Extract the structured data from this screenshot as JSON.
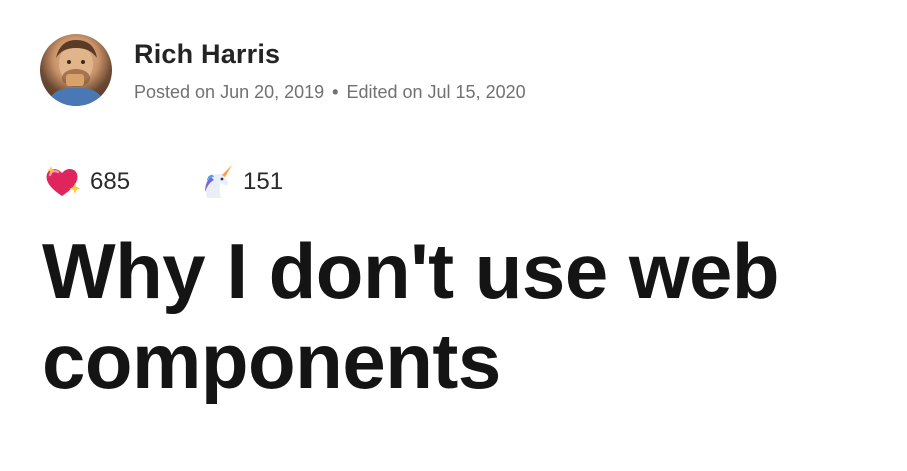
{
  "author": {
    "name": "Rich Harris",
    "posted": "Posted on Jun 20, 2019",
    "separator": "•",
    "edited": "Edited on Jul 15, 2020",
    "avatar_icon": "author-avatar"
  },
  "reactions": [
    {
      "icon": "sparkle-heart-icon",
      "count": "685",
      "color": "#e0245e"
    },
    {
      "icon": "unicorn-icon",
      "count": "151",
      "color": "#8c6bd8"
    }
  ],
  "article": {
    "title": "Why I don't use web components"
  }
}
